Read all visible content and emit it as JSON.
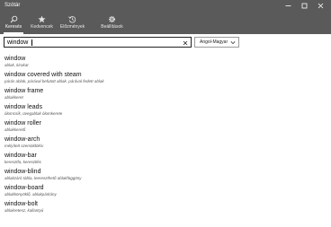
{
  "window": {
    "title": "Szótár",
    "controls": [
      "minimize",
      "maximize",
      "close"
    ]
  },
  "tabs": [
    {
      "label": "Keresés",
      "icon": "search-icon",
      "active": true
    },
    {
      "label": "Kedvencek",
      "icon": "star-icon",
      "active": false
    },
    {
      "label": "Előzmények",
      "icon": "history-icon",
      "active": false
    },
    {
      "label": "Beállítások",
      "icon": "gear-icon",
      "active": false
    }
  ],
  "search": {
    "value": "window"
  },
  "language": {
    "selected": "Angol-Magyar"
  },
  "results": [
    {
      "word": "window",
      "translation": "ablak, kirakat"
    },
    {
      "word": "window covered with steam",
      "translation": "párás ablak, párával befutott ablak, párával fedett ablak"
    },
    {
      "word": "window frame",
      "translation": "ablakkeret"
    },
    {
      "word": "window leads",
      "translation": "ólomcsík, üvegablak ólomkerete"
    },
    {
      "word": "window roller",
      "translation": "ablakkerető"
    },
    {
      "word": "window-arch",
      "translation": "mélyített szemöldökív"
    },
    {
      "word": "window-bar",
      "translation": "keresztfa, keresztléc"
    },
    {
      "word": "window-blind",
      "translation": "ablakzáró tábla, leereszthető ablakfüggöny"
    },
    {
      "word": "window-board",
      "translation": "ablakkönyöklő, ablakpárkány"
    },
    {
      "word": "window-bolt",
      "translation": "ablakretesz, kallantyú"
    }
  ],
  "colors": {
    "titlebar": "#5a5a5a",
    "accent": "#ffffff",
    "text": "#111111",
    "subtext": "#555555"
  }
}
